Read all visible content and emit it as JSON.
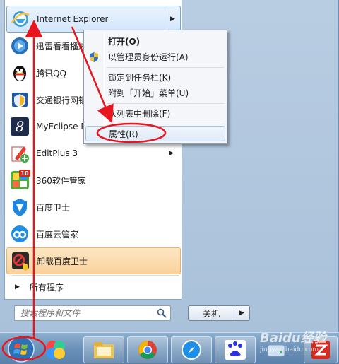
{
  "programs": [
    {
      "label": "Internet Explorer",
      "icon": "internet-explorer-icon",
      "highlight": "blue",
      "has_submenu": true
    },
    {
      "label": "迅雷看看播放",
      "icon": "xunlei-player-icon"
    },
    {
      "label": "腾讯QQ",
      "icon": "qq-penguin-icon"
    },
    {
      "label": "交通银行网银",
      "icon": "bank-shield-icon"
    },
    {
      "label": "MyEclipse P",
      "icon": "myeclipse-icon"
    },
    {
      "label": "EditPlus 3",
      "icon": "editplus-icon",
      "has_submenu": true
    },
    {
      "label": "360软件管家",
      "icon": "360-manager-icon"
    },
    {
      "label": "百度卫士",
      "icon": "baidu-guard-icon"
    },
    {
      "label": "百度云管家",
      "icon": "baidu-cloud-icon"
    },
    {
      "label": "卸载百度卫士",
      "icon": "uninstall-icon",
      "highlight": "orange"
    }
  ],
  "all_programs": "所有程序",
  "search": {
    "placeholder": "搜索程序和文件"
  },
  "shutdown": {
    "label": "关机"
  },
  "context_menu": {
    "items": [
      {
        "label": "打开(O)",
        "bold": true
      },
      {
        "label": "以管理员身份运行(A)",
        "icon": "uac-shield-icon"
      },
      {
        "label": "锁定到任务栏(K)"
      },
      {
        "label": "附到「开始」菜单(U)"
      },
      {
        "label": "从列表中删除(F)"
      },
      {
        "label": "属性(R)",
        "hover": true
      }
    ]
  },
  "badge_360": "10",
  "taskbar": [
    "start-orb-icon",
    "colorful-balls-icon",
    "file-explorer-icon",
    "chrome-icon",
    "safari-compass-icon",
    "baidu-du-icon",
    "disk-icon",
    "zhihu-z-icon"
  ],
  "watermark": {
    "text": "Baidu经验",
    "sub": "jingyan.baidu.com"
  },
  "colors": {
    "annotation_red": "#e8141e",
    "menu_hover": "#dfeaf8",
    "highlight_orange": "#f9d29c"
  }
}
